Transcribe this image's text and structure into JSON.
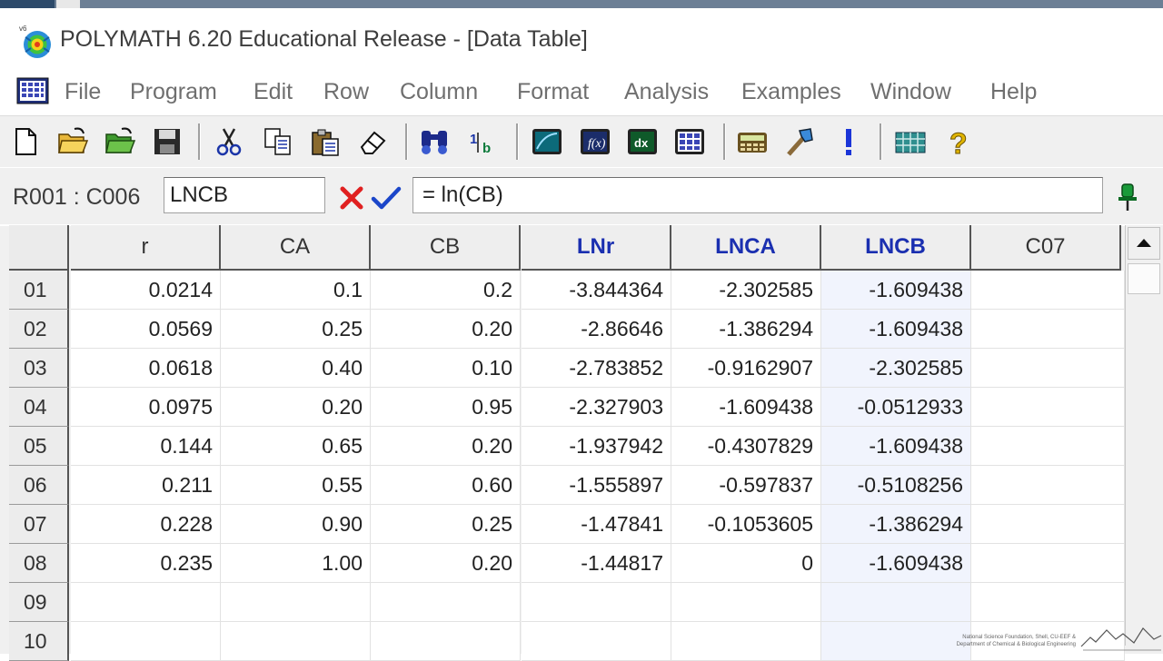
{
  "window": {
    "title": "POLYMATH 6.20 Educational Release - [Data Table]",
    "app_badge": "v6"
  },
  "menu": {
    "items": [
      "File",
      "Program",
      "Edit",
      "Row",
      "Column",
      "Format",
      "Analysis",
      "Examples",
      "Window",
      "Help"
    ]
  },
  "toolbar": {
    "icons": [
      "new-file-icon",
      "open-folder-icon",
      "open-folder-green-icon",
      "save-icon",
      "cut-icon",
      "copy-icon",
      "paste-icon",
      "eraser-icon",
      "find-icon",
      "sort-icon",
      "graph-icon",
      "function-icon",
      "derivative-icon",
      "matrix-icon",
      "calculator-icon",
      "tool-icon",
      "exclamation-icon",
      "table-icon",
      "help-icon"
    ]
  },
  "formula_bar": {
    "cell_ref": "R001 : C006",
    "name_value": "LNCB",
    "formula_value": "= ln(CB)"
  },
  "table": {
    "columns": [
      {
        "label": "r",
        "highlight": false
      },
      {
        "label": "CA",
        "highlight": false
      },
      {
        "label": "CB",
        "highlight": false
      },
      {
        "label": "LNr",
        "highlight": true
      },
      {
        "label": "LNCA",
        "highlight": true
      },
      {
        "label": "LNCB",
        "highlight": true
      },
      {
        "label": "C07",
        "highlight": false
      }
    ],
    "rows": [
      {
        "id": "01",
        "cells": [
          "0.0214",
          "0.1",
          "0.2",
          "-3.844364",
          "-2.302585",
          "-1.609438",
          ""
        ]
      },
      {
        "id": "02",
        "cells": [
          "0.0569",
          "0.25",
          "0.20",
          "-2.86646",
          "-1.386294",
          "-1.609438",
          ""
        ]
      },
      {
        "id": "03",
        "cells": [
          "0.0618",
          "0.40",
          "0.10",
          "-2.783852",
          "-0.9162907",
          "-2.302585",
          ""
        ]
      },
      {
        "id": "04",
        "cells": [
          "0.0975",
          "0.20",
          "0.95",
          "-2.327903",
          "-1.609438",
          "-0.0512933",
          ""
        ]
      },
      {
        "id": "05",
        "cells": [
          "0.144",
          "0.65",
          "0.20",
          "-1.937942",
          "-0.4307829",
          "-1.609438",
          ""
        ]
      },
      {
        "id": "06",
        "cells": [
          "0.211",
          "0.55",
          "0.60",
          "-1.555897",
          "-0.597837",
          "-0.5108256",
          ""
        ]
      },
      {
        "id": "07",
        "cells": [
          "0.228",
          "0.90",
          "0.25",
          "-1.47841",
          "-0.1053605",
          "-1.386294",
          ""
        ]
      },
      {
        "id": "08",
        "cells": [
          "0.235",
          "1.00",
          "0.20",
          "-1.44817",
          "0",
          "-1.609438",
          ""
        ]
      },
      {
        "id": "09",
        "cells": [
          "",
          "",
          "",
          "",
          "",
          "",
          ""
        ]
      },
      {
        "id": "10",
        "cells": [
          "",
          "",
          "",
          "",
          "",
          "",
          ""
        ]
      }
    ]
  },
  "footer": {
    "credit_line1": "National Science Foundation, Shell, CU-EEF &",
    "credit_line2": "Department of Chemical & Biological Engineering"
  },
  "colors": {
    "highlight_column_text": "#1a2fb0",
    "selected_column_bg": "#f1f4fd",
    "cancel_red": "#e02020",
    "ok_blue": "#1b46c9"
  }
}
